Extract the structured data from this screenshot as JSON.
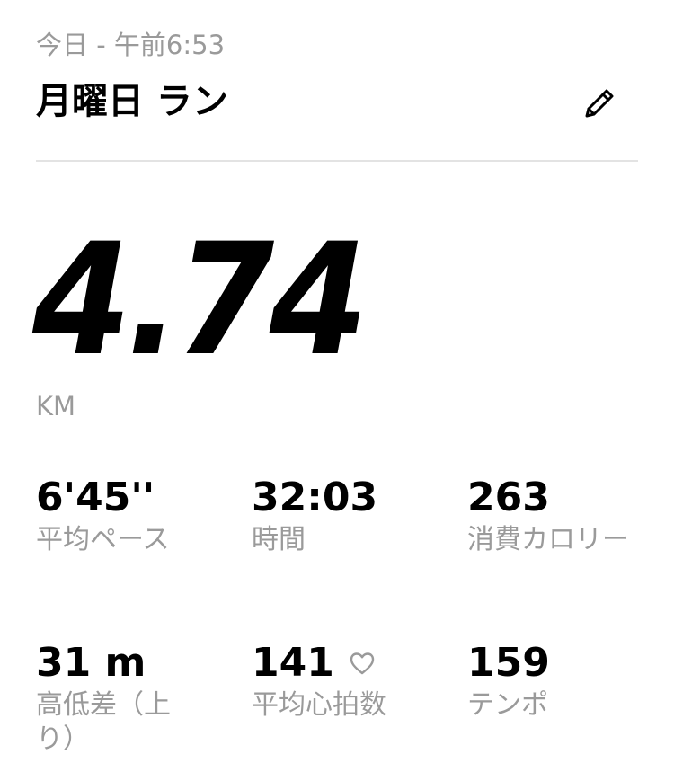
{
  "header": {
    "date_label": "今日 - 午前6:53",
    "title": "月曜日 ラン",
    "edit_icon": "pencil-icon"
  },
  "distance": {
    "value": "4.74",
    "unit": "KM"
  },
  "stats": [
    {
      "value": "6'45''",
      "label": "平均ペース"
    },
    {
      "value": "32:03",
      "label": "時間"
    },
    {
      "value": "263",
      "label": "消費カロリー"
    },
    {
      "value": "31 m",
      "label": "高低差（上り）"
    },
    {
      "value": "141",
      "label": "平均心拍数",
      "icon": "heart-icon"
    },
    {
      "value": "159",
      "label": "テンポ"
    }
  ]
}
